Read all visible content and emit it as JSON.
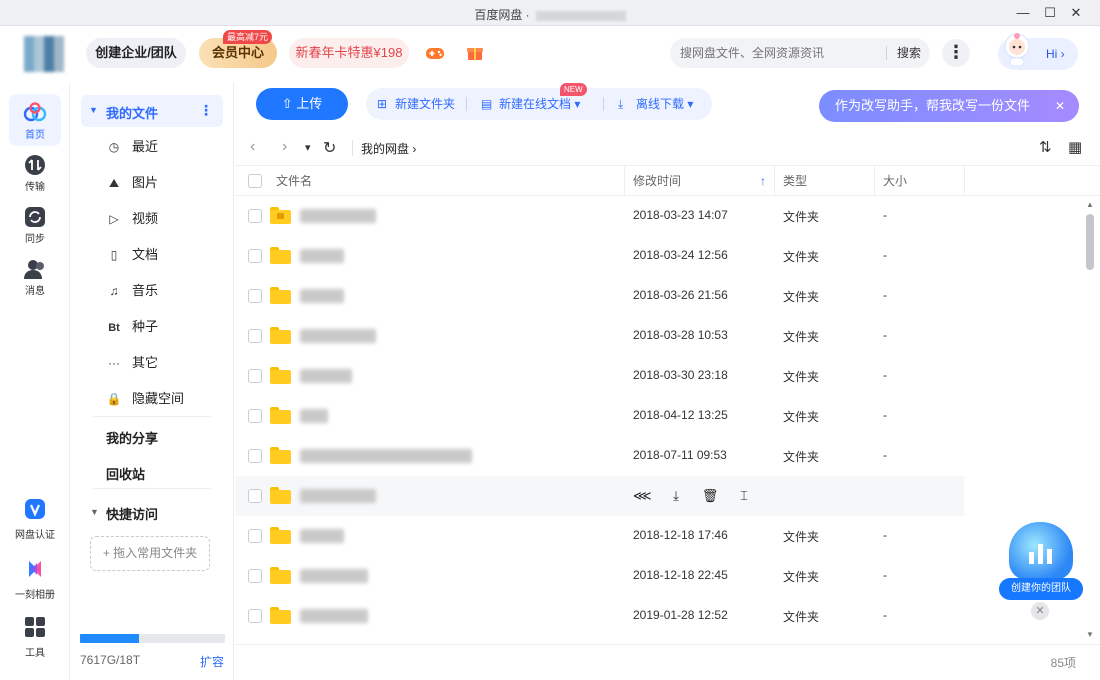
{
  "window": {
    "title": "百度网盘",
    "title_sep": "·",
    "minimize": "—",
    "maximize": "☐",
    "close": "✕"
  },
  "header": {
    "team_label": "创建企业/团队",
    "vip_label": "会员中心",
    "vip_tag": "最高减7元",
    "promo_label": "新春年卡特惠¥198",
    "search_placeholder": "搜网盘文件、全网资源资讯",
    "search_button": "搜索",
    "more": "⋮",
    "hi": "Hi ›"
  },
  "rail": [
    {
      "label": "首页",
      "icon": "home-icon",
      "active": true
    },
    {
      "label": "传输",
      "icon": "transfer-icon"
    },
    {
      "label": "同步",
      "icon": "sync-icon"
    },
    {
      "label": "消息",
      "icon": "message-icon"
    }
  ],
  "rail_bottom": [
    {
      "label": "网盘认证",
      "icon": "verify-icon"
    },
    {
      "label": "一刻相册",
      "icon": "album-icon"
    },
    {
      "label": "工具",
      "icon": "tools-icon"
    }
  ],
  "nav": {
    "my_files": "我的文件",
    "more": "⋮",
    "items": [
      {
        "label": "最近",
        "icon": "clock-icon",
        "glyph": "◷"
      },
      {
        "label": "图片",
        "icon": "image-icon",
        "glyph": "⛰"
      },
      {
        "label": "视频",
        "icon": "video-icon",
        "glyph": "▷"
      },
      {
        "label": "文档",
        "icon": "document-icon",
        "glyph": "▯"
      },
      {
        "label": "音乐",
        "icon": "music-icon",
        "glyph": "♫"
      },
      {
        "label": "种子",
        "icon": "bt-icon",
        "glyph": "Bt"
      },
      {
        "label": "其它",
        "icon": "other-icon",
        "glyph": "···"
      },
      {
        "label": "隐藏空间",
        "icon": "lock-icon",
        "glyph": "🔒"
      }
    ],
    "my_share": "我的分享",
    "recycle": "回收站",
    "quick_access": "快捷访问",
    "drop_hint": "+ 拖入常用文件夹",
    "storage_used_fraction": 0.41,
    "storage_text": "7617G/18T",
    "expand": "扩容"
  },
  "toolbar": {
    "upload": "上传",
    "new_folder": "新建文件夹",
    "new_online_doc": "新建在线文档",
    "new_tag": "NEW",
    "offline_download": "离线下载",
    "assistant": "作为改写助手，帮我改写一份文件",
    "assistant_close": "✕"
  },
  "pathbar": {
    "back": "‹",
    "forward": "›",
    "dropdown": "▾",
    "refresh": "↻",
    "path": "我的网盘",
    "path_arrow": "›",
    "sort": "⇅",
    "grid": "▦"
  },
  "table": {
    "headers": {
      "name": "文件名",
      "mtime": "修改时间",
      "sort_arrow": "↑",
      "type": "类型",
      "size": "大小"
    },
    "rows": [
      {
        "date": "2018-03-23 14:07",
        "type": "文件夹",
        "size": "-",
        "name_w": 76,
        "locked": true
      },
      {
        "date": "2018-03-24 12:56",
        "type": "文件夹",
        "size": "-",
        "name_w": 44
      },
      {
        "date": "2018-03-26 21:56",
        "type": "文件夹",
        "size": "-",
        "name_w": 44
      },
      {
        "date": "2018-03-28 10:53",
        "type": "文件夹",
        "size": "-",
        "name_w": 76
      },
      {
        "date": "2018-03-30 23:18",
        "type": "文件夹",
        "size": "-",
        "name_w": 52
      },
      {
        "date": "2018-04-12 13:25",
        "type": "文件夹",
        "size": "-",
        "name_w": 28
      },
      {
        "date": "2018-07-11 09:53",
        "type": "文件夹",
        "size": "-",
        "name_w": 172
      },
      {
        "date": "",
        "type": "",
        "size": "",
        "name_w": 76,
        "hover": true
      },
      {
        "date": "2018-12-18 17:46",
        "type": "文件夹",
        "size": "-",
        "name_w": 44
      },
      {
        "date": "2018-12-18 22:45",
        "type": "文件夹",
        "size": "-",
        "name_w": 68
      },
      {
        "date": "2019-01-28 12:52",
        "type": "文件夹",
        "size": "-",
        "name_w": 68
      }
    ],
    "count": "85项"
  },
  "float": {
    "team_label": "创建你的团队",
    "close": "✕"
  },
  "colors": {
    "accent": "#1f78ff",
    "folder": "#ffcc1f",
    "promo": "#e2454a"
  }
}
